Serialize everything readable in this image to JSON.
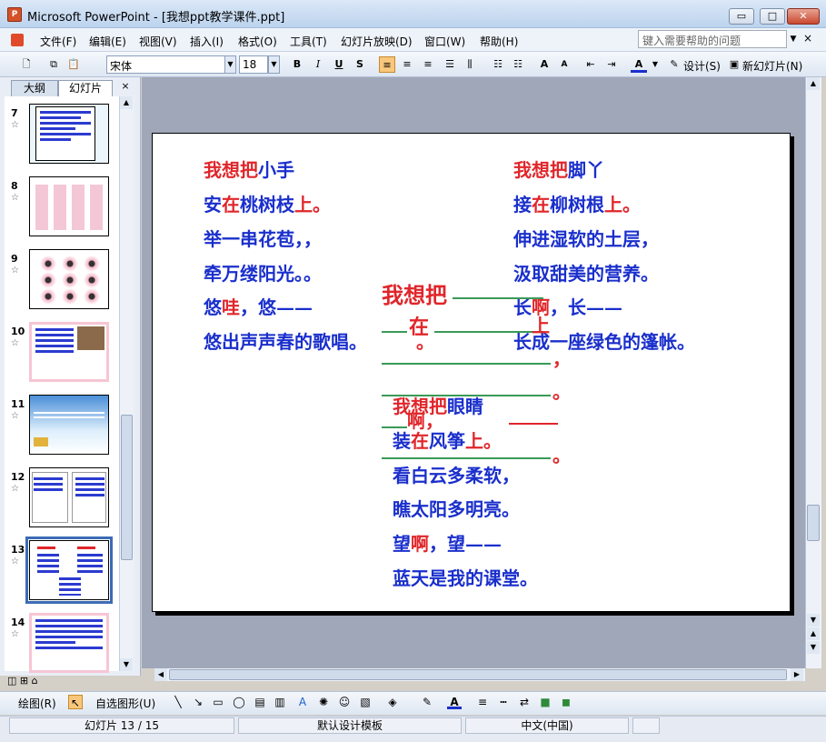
{
  "window": {
    "title": "Microsoft PowerPoint - [我想ppt教学课件.ppt]",
    "minimize": "▭",
    "maximize": "□",
    "close": "✕"
  },
  "menu": {
    "items": [
      "文件(F)",
      "编辑(E)",
      "视图(V)",
      "插入(I)",
      "格式(O)",
      "工具(T)",
      "幻灯片放映(D)",
      "窗口(W)",
      "帮助(H)"
    ],
    "help_placeholder": "键入需要帮助的问题"
  },
  "toolbar": {
    "font_name": "宋体",
    "font_size": "18",
    "bold": "B",
    "italic": "I",
    "underline": "U",
    "shadow": "S",
    "design_label": "设计(S)",
    "new_slide_label": "新幻灯片(N)"
  },
  "panel": {
    "tab_outline": "大纲",
    "tab_slides": "幻灯片",
    "close": "×",
    "thumbnails": [
      {
        "num": "7"
      },
      {
        "num": "8"
      },
      {
        "num": "9"
      },
      {
        "num": "10"
      },
      {
        "num": "11"
      },
      {
        "num": "12"
      },
      {
        "num": "13"
      },
      {
        "num": "14"
      }
    ]
  },
  "slide": {
    "left_poem": {
      "l1a": "我想把",
      "l1b": "小手",
      "l2a": "安",
      "l2b": "在",
      "l2c": "桃树枝",
      "l2d": "上",
      "l2e": "。",
      "l3": "举一串花苞，，",
      "l4": "牵万缕阳光。。",
      "l5a": "悠",
      "l5b": "哇",
      "l5c": "，悠——",
      "l6": "悠出声声春的歌唱。"
    },
    "right_poem": {
      "l1a": "我想把",
      "l1b": "脚丫",
      "l2a": "接",
      "l2b": "在",
      "l2c": "柳树根",
      "l2d": "上",
      "l2e": "。",
      "l3": "伸进湿软的土层，",
      "l4": "汲取甜美的营养。",
      "l5a": "长",
      "l5b": "啊",
      "l5c": "，长——",
      "l6": "长成一座绿色的篷帐。"
    },
    "center_template": {
      "want": "我想把",
      "at": "在",
      "up": "上",
      "period": "。",
      "comma": "，",
      "ah": "啊，",
      "dot": "。"
    },
    "bottom_poem": {
      "l1a": "我想把",
      "l1b": "眼睛",
      "l2a": "装",
      "l2b": "在",
      "l2c": "风筝",
      "l2d": "上",
      "l2e": "。",
      "l3": "看白云多柔软，",
      "l4": "瞧太阳多明亮。",
      "l5a": "望",
      "l5b": "啊",
      "l5c": "，望——",
      "l6": "蓝天是我的课堂。"
    }
  },
  "draw": {
    "draw_label": "绘图(R)",
    "autoshape_label": "自选图形(U)"
  },
  "status": {
    "slide_info": "幻灯片 13 / 15",
    "template": "默认设计模板",
    "language": "中文(中国)"
  },
  "colors": {
    "text_blue": "#1a2fcc",
    "text_red": "#e0262b",
    "line_green": "#3a9a58"
  }
}
